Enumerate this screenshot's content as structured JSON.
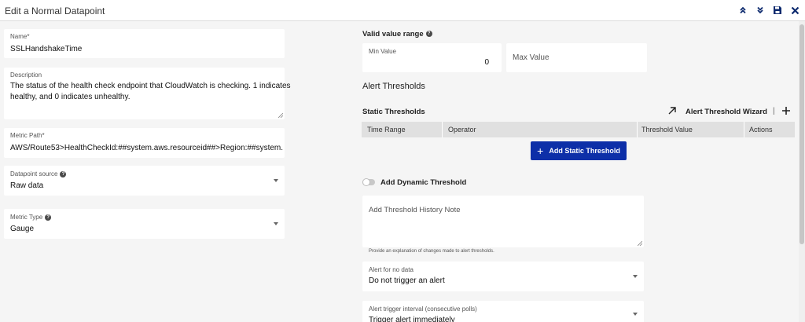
{
  "header": {
    "title": "Edit a Normal Datapoint"
  },
  "left": {
    "name": {
      "label": "Name*",
      "value": "SSLHandshakeTime"
    },
    "description": {
      "label": "Description",
      "line1": "The status of the health check endpoint that CloudWatch is checking. 1 indicates",
      "line2": "healthy, and 0 indicates unhealthy."
    },
    "metric_path": {
      "label": "Metric Path*",
      "value": "AWS/Route53>HealthCheckId:##system.aws.resourceid##>Region:##system."
    },
    "datapoint_source": {
      "label": "Datapoint source",
      "value": "Raw data"
    },
    "metric_type": {
      "label": "Metric Type",
      "value": "Gauge"
    }
  },
  "right": {
    "valid_range": {
      "title": "Valid value range",
      "min_label": "Min Value",
      "min_value": "0",
      "max_placeholder": "Max Value"
    },
    "alert_thresholds_title": "Alert Thresholds",
    "static": {
      "title": "Static Thresholds",
      "wizard_label": "Alert Threshold Wizard",
      "separator": "|",
      "columns": [
        "Time Range",
        "Operator",
        "Threshold Value",
        "Actions"
      ],
      "add_button": "Add Static Threshold"
    },
    "dynamic_label": "Add Dynamic Threshold",
    "history_note": {
      "placeholder": "Add Threshold History Note",
      "helper": "Provide an explanation of changes made to alert thresholds."
    },
    "alert_no_data": {
      "label": "Alert for no data",
      "value": "Do not trigger an alert"
    },
    "alert_trigger_interval": {
      "label": "Alert trigger interval (consecutive polls)",
      "value": "Trigger alert immediately"
    }
  },
  "colors": {
    "primary_button": "#0d2fa8",
    "icon_navy": "#0d2a6e"
  }
}
